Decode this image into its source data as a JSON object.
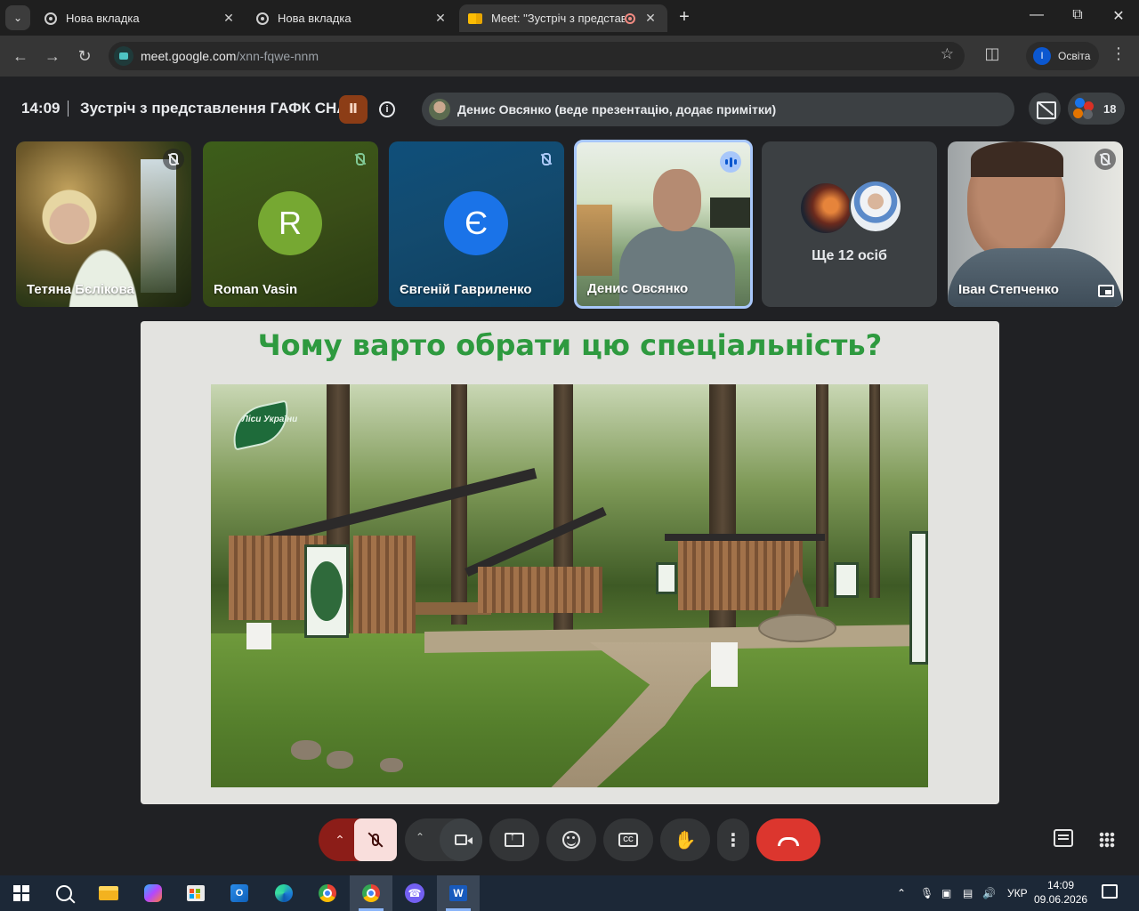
{
  "browser": {
    "tabs": [
      {
        "label": "Нова вкладка",
        "active": false
      },
      {
        "label": "Нова вкладка",
        "active": false
      },
      {
        "label": "Meet: \"Зустріч з представл",
        "active": true
      }
    ],
    "url_host": "meet.google.com",
    "url_path": "/xnn-fqwe-nnm",
    "profile_initial": "I",
    "profile_name": "Освіта"
  },
  "meeting": {
    "time": "14:09",
    "title": "Зустріч з представлення ГАФК СНАУ",
    "presenter": "Денис Овсянко (веде презентацію, додає примітки)",
    "people_count": "18"
  },
  "participants": [
    {
      "name": "Тетяна Бєлікова",
      "initial": ""
    },
    {
      "name": "Roman Vasin",
      "initial": "R"
    },
    {
      "name": "Євгеній Гавриленко",
      "initial": "Є"
    },
    {
      "name": "Денис Овсянко",
      "initial": ""
    },
    {
      "name": "Ще 12 осіб",
      "initial": ""
    },
    {
      "name": "Іван Степченко",
      "initial": ""
    }
  ],
  "slide": {
    "title": "Чому варто обрати цю спеціальність?",
    "logo_text": "Ліси України"
  },
  "taskbar": {
    "language": "УКР",
    "time": "14:09",
    "date": "09.06.2026"
  }
}
